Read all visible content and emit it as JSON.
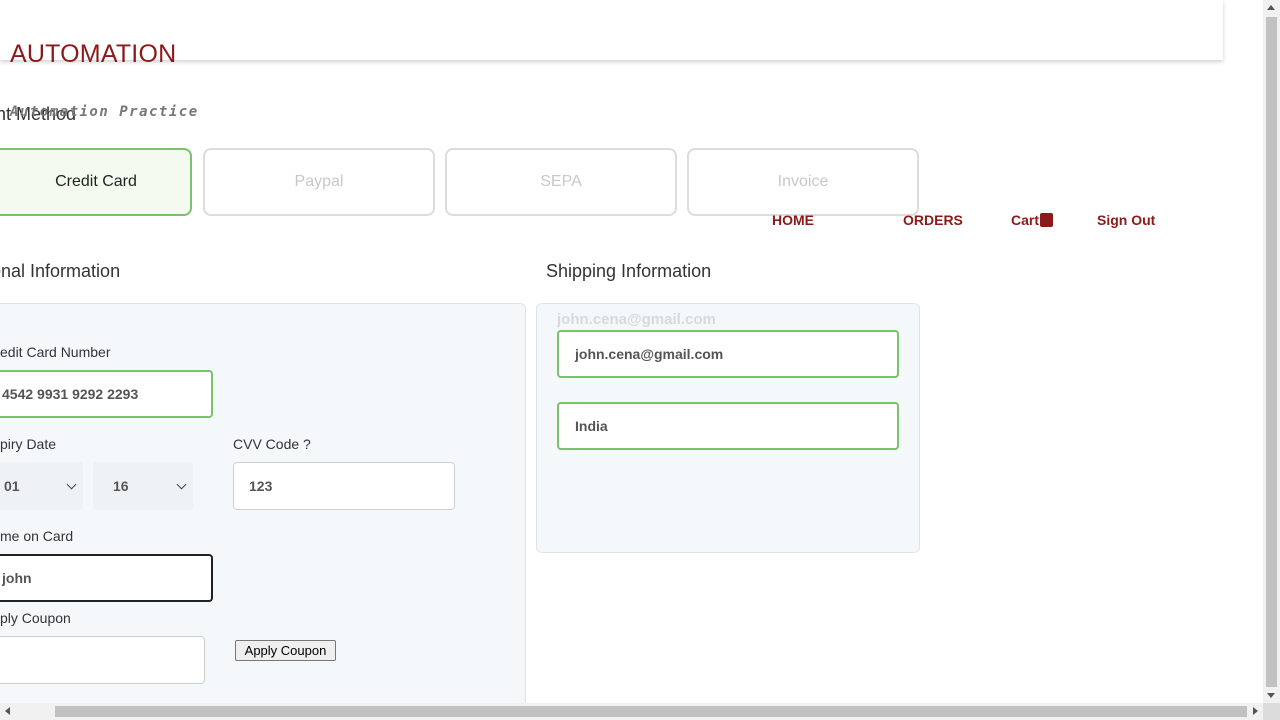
{
  "brand": {
    "title": "AUTOMATION",
    "subtitle": "Automation Practice"
  },
  "nav": {
    "home": "HOME",
    "orders": "ORDERS",
    "cart": "Cart",
    "sign_out": "Sign Out"
  },
  "payment": {
    "title": "Payment Method",
    "visible_title": "nent Method",
    "options": [
      {
        "label": "Credit Card",
        "selected": true
      },
      {
        "label": "Paypal",
        "selected": false
      },
      {
        "label": "SEPA",
        "selected": false
      },
      {
        "label": "Invoice",
        "selected": false
      }
    ]
  },
  "personal": {
    "title": "sonal Information",
    "card_number_label": "edit Card Number",
    "card_number": "4542 9931 9292 2293",
    "expiry_label": "piry Date",
    "expiry_month": "01",
    "expiry_year": "16",
    "cvv_label": "CVV Code ?",
    "cvv": "123",
    "name_label": "me on Card",
    "name": "john",
    "coupon_label": "ply Coupon",
    "coupon_value": "",
    "apply_button": "Apply Coupon"
  },
  "shipping": {
    "title": "Shipping Information",
    "email_hint": "john.cena@gmail.com",
    "email": "john.cena@gmail.com",
    "country": "India"
  },
  "colors": {
    "brand": "#8b1a1a",
    "selected_border": "#7ac36a",
    "selected_bg": "#f3fbf1",
    "panel_bg": "#f5f8fb"
  }
}
